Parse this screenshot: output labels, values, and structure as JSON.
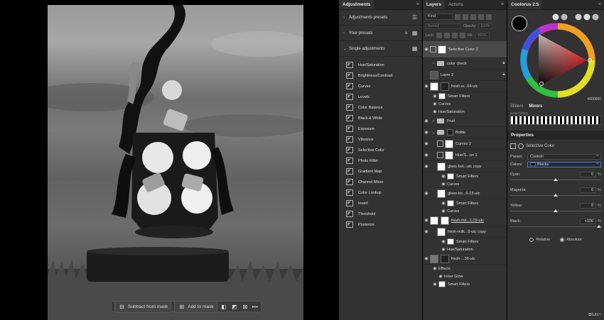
{
  "canvas": {
    "context_bar": {
      "subtract_label": "Subtract from mask",
      "add_label": "Add to mask",
      "more_label": "•••"
    }
  },
  "adjustments_panel": {
    "tab": "Adjustments",
    "groups": [
      {
        "label": "Adjustments presets",
        "icon": "list-icon"
      },
      {
        "label": "Your presets",
        "icon": "plus-icon"
      },
      {
        "label": "Single adjustments",
        "icon": "grid-icon"
      }
    ],
    "items": [
      "Hue/Saturation",
      "Brightness/Contrast",
      "Curves",
      "Levels",
      "Color Balance",
      "Black & White",
      "Exposure",
      "Vibrance",
      "Selective Color",
      "Photo Filter",
      "Gradient Map",
      "Channel Mixer",
      "Color Lookup",
      "Invert",
      "Threshold",
      "Posterize"
    ]
  },
  "layers_panel": {
    "tabs": [
      "Layers",
      "Actions"
    ],
    "kind": "Kind",
    "blend_mode": "Normal",
    "opacity_label": "Opacity:",
    "opacity_value": "100%",
    "lock_label": "Lock:",
    "fill_label": "Fill:",
    "fill_value": "100%",
    "layers": [
      {
        "name": "Selective Color 2",
        "type": "adjustment",
        "selected": true
      },
      {
        "name": "color check",
        "type": "folder",
        "lock": true
      },
      {
        "name": "Layer 3",
        "type": "pixel",
        "lock": true
      },
      {
        "name": "fresh-w...04-utc",
        "type": "smart"
      },
      {
        "name": "Smart Filters",
        "type": "filters"
      },
      {
        "name": "Curves",
        "type": "filter"
      },
      {
        "name": "Hue/Saturation",
        "type": "filter"
      },
      {
        "name": "Fruit",
        "type": "folder"
      },
      {
        "name": "Bottle",
        "type": "folder"
      },
      {
        "name": "Curves 2",
        "type": "adjustment"
      },
      {
        "name": "Hue/S...on 1",
        "type": "adjustment"
      },
      {
        "name": "glass-bot...utc copy",
        "type": "smart"
      },
      {
        "name": "Smart Filters",
        "type": "filters"
      },
      {
        "name": "Curves",
        "type": "filter"
      },
      {
        "name": "glass-bo...6-13-utc",
        "type": "smart"
      },
      {
        "name": "Smart Filters",
        "type": "filters"
      },
      {
        "name": "Curves",
        "type": "filter"
      },
      {
        "name": "fresh-mil...1-29-utc",
        "type": "smart"
      },
      {
        "name": "fresh-milk...0-utc copy",
        "type": "smart"
      },
      {
        "name": "Smart Filters",
        "type": "filters"
      },
      {
        "name": "Hue/Saturation",
        "type": "filter"
      },
      {
        "name": "fresh-...36-utc",
        "type": "smart"
      },
      {
        "name": "Effects",
        "type": "effects"
      },
      {
        "name": "Inner Glow",
        "type": "filter"
      },
      {
        "name": "Smart Filters",
        "type": "filters"
      }
    ]
  },
  "colour_panel": {
    "tab": "Coolorus 2.5",
    "hex_value": "000000",
    "mini_tabs": [
      "Sliders",
      "Mixers"
    ],
    "history_label": "Color history"
  },
  "properties": {
    "title": "Properties",
    "adjustment": "Selective Color",
    "preset_label": "Preset:",
    "preset_value": "Custom",
    "colors_label": "Colors:",
    "colors_value": "Blacks",
    "sliders": [
      {
        "name": "Cyan:",
        "value": "0",
        "level": 0.5
      },
      {
        "name": "Magenta:",
        "value": "0",
        "level": 0.5
      },
      {
        "name": "Yellow:",
        "value": "0",
        "level": 0.5
      },
      {
        "name": "Black:",
        "value": "+100",
        "level": 1.0
      }
    ],
    "pct": "%",
    "relative_label": "Relative",
    "absolute_label": "Absolute",
    "watermark": "tuts+"
  }
}
